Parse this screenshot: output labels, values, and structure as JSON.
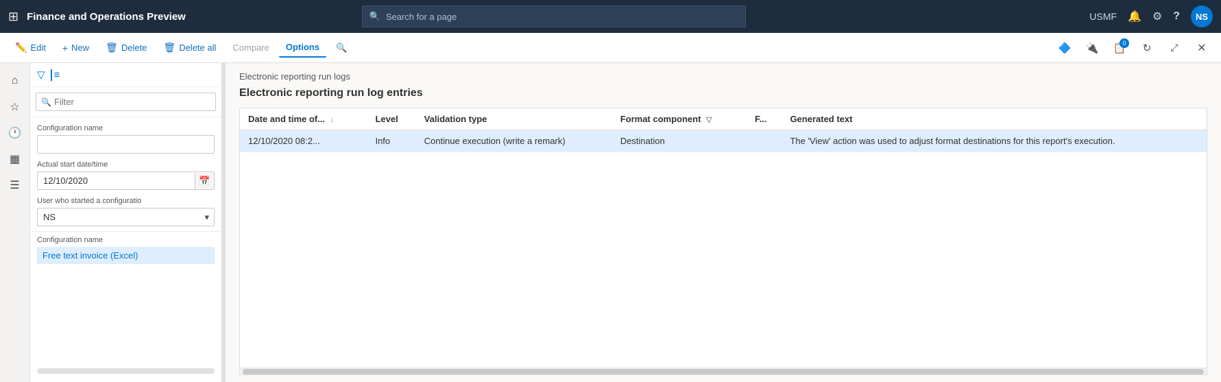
{
  "app": {
    "title": "Finance and Operations Preview",
    "search_placeholder": "Search for a page",
    "user_env": "USMF",
    "user_initials": "NS"
  },
  "toolbar": {
    "edit_label": "Edit",
    "new_label": "New",
    "delete_label": "Delete",
    "delete_all_label": "Delete all",
    "compare_label": "Compare",
    "options_label": "Options"
  },
  "filter": {
    "search_placeholder": "Filter",
    "config_name_label": "Configuration name",
    "config_name_value": "",
    "start_date_label": "Actual start date/time",
    "start_date_value": "12/10/2020",
    "user_label": "User who started a configuratio",
    "user_value": "NS",
    "config_list_header": "Configuration name",
    "config_list_items": [
      {
        "label": "Free text invoice (Excel)",
        "selected": true
      }
    ]
  },
  "content": {
    "breadcrumb": "Electronic reporting run logs",
    "section_title": "Electronic reporting run log entries",
    "table": {
      "columns": [
        {
          "key": "date_time",
          "label": "Date and time of...",
          "sortable": true
        },
        {
          "key": "level",
          "label": "Level"
        },
        {
          "key": "validation_type",
          "label": "Validation type"
        },
        {
          "key": "format_component",
          "label": "Format component",
          "filterable": true
        },
        {
          "key": "f",
          "label": "F..."
        },
        {
          "key": "generated_text",
          "label": "Generated text"
        }
      ],
      "rows": [
        {
          "date_time": "12/10/2020 08:2...",
          "level": "Info",
          "validation_type": "Continue execution (write a remark)",
          "format_component": "Destination",
          "f": "",
          "generated_text": "The 'View' action was used to adjust format destinations for this report's execution.",
          "selected": true
        }
      ]
    }
  }
}
